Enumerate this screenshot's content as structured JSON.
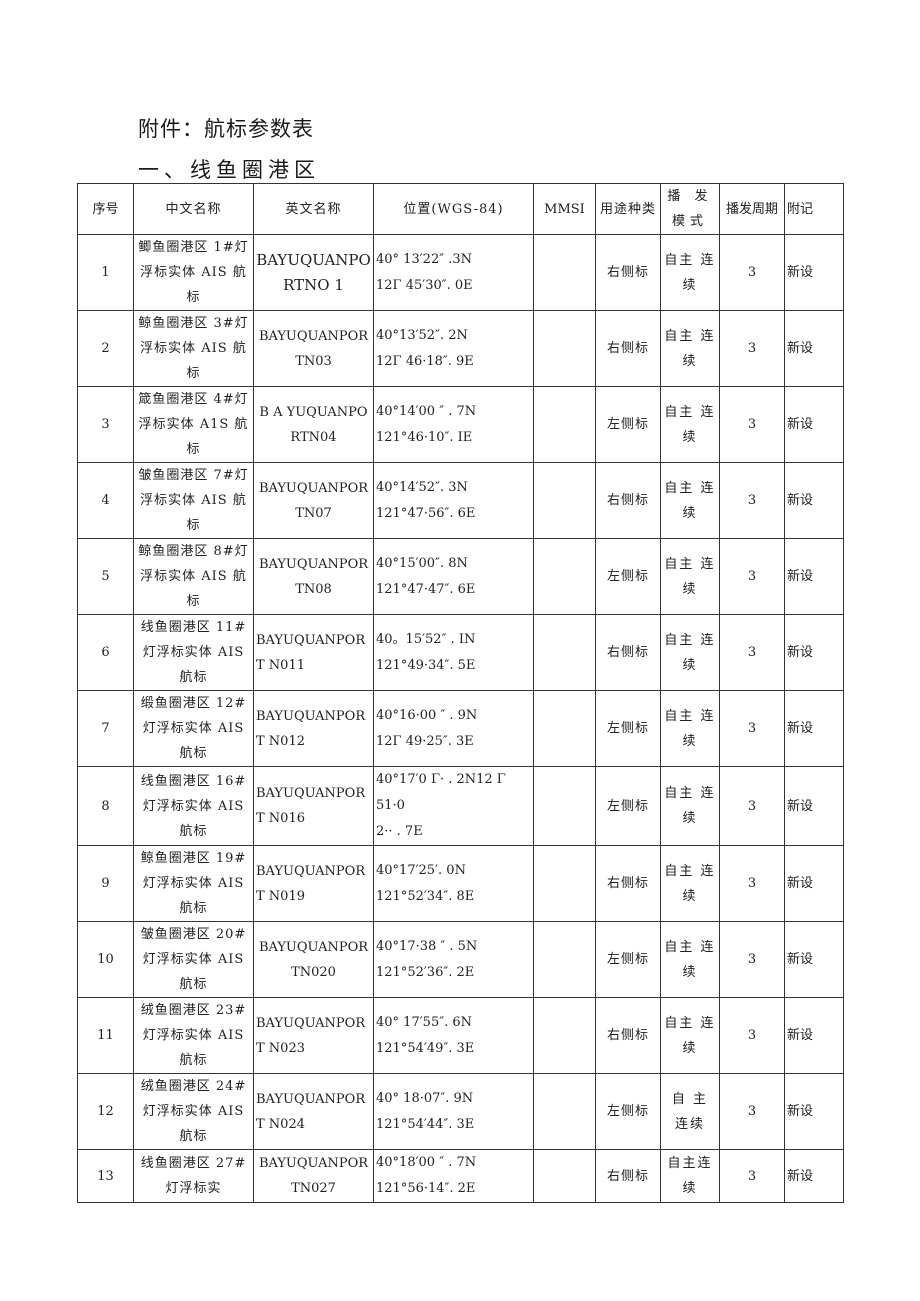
{
  "document": {
    "title": "附件：航标参数表",
    "section": "一、线鱼圈港区"
  },
  "table": {
    "headers": {
      "index": "序号",
      "cn_name": "中文名称",
      "en_name": "英文名称",
      "position": "位置(WGS-84)",
      "mmsi": "MMSI",
      "usage": "用途种类",
      "mode": "播 发 模式",
      "period": "播发周期",
      "note": "附记"
    },
    "rows": [
      {
        "index": "1",
        "cn_name": "鲫鱼圈港区 1#灯浮标实体 AIS 航标",
        "en_name": "BAYUQUANPORTNO 1",
        "lat": "40° 13′22″ .3N",
        "lon": "12Γ 45′30″. 0E",
        "mmsi": "",
        "usage": "右侧标",
        "mode": "自主 连续",
        "period": "3",
        "note": "新设"
      },
      {
        "index": "2",
        "cn_name": "鲸鱼圈港区 3#灯浮标实体 AIS 航标",
        "en_name": "BAYUQUANPORTN03",
        "lat": "40°13′52″. 2N",
        "lon": "12Γ 46·18″. 9E",
        "mmsi": "",
        "usage": "右侧标",
        "mode": "自主 连续",
        "period": "3",
        "note": "新设"
      },
      {
        "index": "3",
        "cn_name": "箴鱼圈港区 4#灯浮标实体 A1S 航标",
        "en_name": "B A YUQUANPORTN04",
        "lat": "40°14′00 ″ . 7N",
        "lon": "121°46·10″. IE",
        "mmsi": "",
        "usage": "左侧标",
        "mode": "自主 连续",
        "period": "3",
        "note": "新设"
      },
      {
        "index": "4",
        "cn_name": "皱鱼圈港区 7#灯浮标实体 AIS 航标",
        "en_name": "BAYUQUANPORTN07",
        "lat": "40°14′52″. 3N",
        "lon": "121°47·56″. 6E",
        "mmsi": "",
        "usage": "右侧标",
        "mode": "自主 连续",
        "period": "3",
        "note": "新设"
      },
      {
        "index": "5",
        "cn_name": "鲸鱼圈港区 8#灯浮标实体 AIS 航标",
        "en_name": "BAYUQUANPORTN08",
        "lat": "40°15′00″. 8N",
        "lon": "121°47·47″. 6E",
        "mmsi": "",
        "usage": "左侧标",
        "mode": "自主 连续",
        "period": "3",
        "note": "新设"
      },
      {
        "index": "6",
        "cn_name": "线鱼圈港区 11#灯浮标实体 AIS 航标",
        "en_name": "BAYUQUANPORT N011",
        "lat": "40。15′52″ . IN",
        "lon": "121°49·34″. 5E",
        "mmsi": "",
        "usage": "右侧标",
        "mode": "自主 连续",
        "period": "3",
        "note": "新设"
      },
      {
        "index": "7",
        "cn_name": "缎鱼圈港区 12#灯浮标实体 AIS 航标",
        "en_name": "BAYUQUANPORT N012",
        "lat": "40°16·00 ″ . 9N",
        "lon": "12Γ 49·25″. 3E",
        "mmsi": "",
        "usage": "左侧标",
        "mode": "自主 连续",
        "period": "3",
        "note": "新设"
      },
      {
        "index": "8",
        "cn_name": "线鱼圈港区 16#灯浮标实体 AIS 航标",
        "en_name": "BAYUQUANPORT N016",
        "lat": "40°17′0 Γ· . 2N12 Γ 51·0",
        "lon": "2·· . 7E",
        "mmsi": "",
        "usage": "左侧标",
        "mode": "自主 连续",
        "period": "3",
        "note": "新设"
      },
      {
        "index": "9",
        "cn_name": "鲸鱼圈港区 19#灯浮标实体 AIS 航标",
        "en_name": "BAYUQUANPORT N019",
        "lat": "40°17′25′. 0N",
        "lon": "121°52′34″. 8E",
        "mmsi": "",
        "usage": "右侧标",
        "mode": "自主 连续",
        "period": "3",
        "note": "新设"
      },
      {
        "index": "10",
        "cn_name": "皱鱼圈港区 20#灯浮标实体 AIS 航标",
        "en_name": "BAYUQUANPORTN020",
        "lat": "40°17·38 ″ . 5N",
        "lon": "121°52′36″. 2E",
        "mmsi": "",
        "usage": "左侧标",
        "mode": "自主 连续",
        "period": "3",
        "note": "新设"
      },
      {
        "index": "11",
        "cn_name": "绒鱼圈港区 23#灯浮标实体 AIS 航标",
        "en_name": "BAYUQUANPORT N023",
        "lat": "40° 17′55″. 6N",
        "lon": "121°54′49″. 3E",
        "mmsi": "",
        "usage": "右侧标",
        "mode": "自主 连续",
        "period": "3",
        "note": "新设"
      },
      {
        "index": "12",
        "cn_name": "绒鱼圈港区 24#灯浮标实体 AIS 航标",
        "en_name": "BAYUQUANPORT N024",
        "lat": "40° 18·07″. 9N",
        "lon": "121°54′44″. 3E",
        "mmsi": "",
        "usage": "左侧标",
        "mode": "自  主 连续",
        "period": "3",
        "note": "新设"
      },
      {
        "index": "13",
        "cn_name": "线鱼圈港区 27#灯浮标实",
        "en_name": "BAYUQUANPORTN027",
        "lat": "40°18′00 ″ . 7N",
        "lon": "121°56·14″. 2E",
        "mmsi": "",
        "usage": "右侧标",
        "mode": "自主连续",
        "period": "3",
        "note": "新设"
      }
    ]
  }
}
